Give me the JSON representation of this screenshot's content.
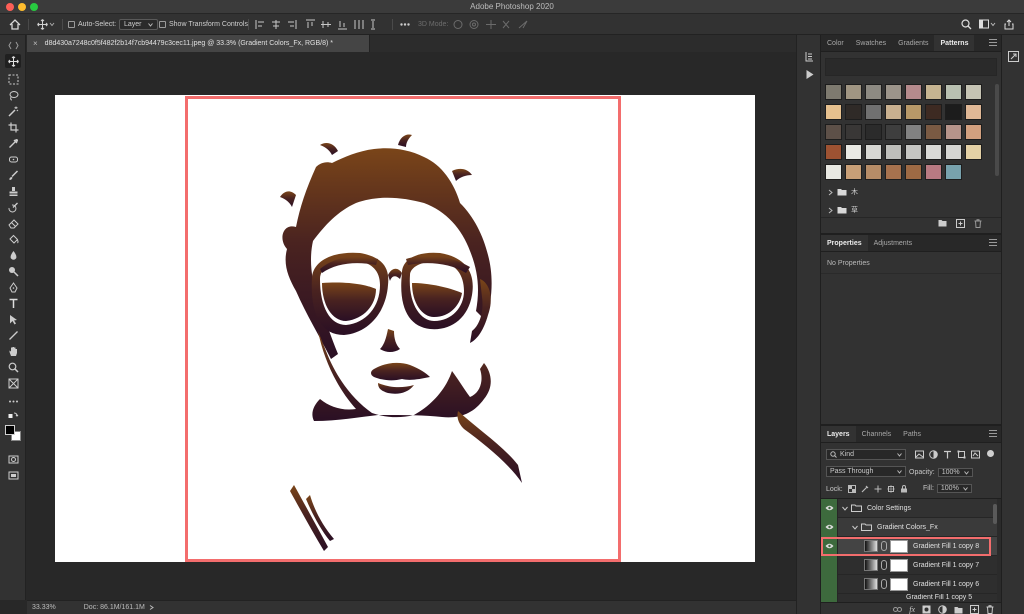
{
  "app": {
    "window_title": "Adobe Photoshop 2020"
  },
  "options_bar": {
    "auto_select_label": "Auto-Select:",
    "auto_select_value": "Layer",
    "transform_controls_label": "Show Transform Controls",
    "three_d_mode_label": "3D Mode:"
  },
  "document": {
    "tab_title": "d8d430a7248c0f5f482f2b14f7cb94479c3cec11.jpeg @ 33.3% (Gradient Colors_Fx, RGB/8) *",
    "close_glyph": "×"
  },
  "status_bar": {
    "zoom": "33.33%",
    "doc_info": "Doc: 86.1M/161.1M"
  },
  "patterns_panel": {
    "tabs": [
      "Color",
      "Swatches",
      "Gradients",
      "Patterns"
    ],
    "active_tab": "Patterns",
    "folders": [
      {
        "label": "木"
      },
      {
        "label": "草"
      }
    ],
    "swatch_colors": [
      [
        "#7e7a6f",
        "#a09582",
        "#8d8a82",
        "#9c948a",
        "#b58a8c",
        "#c6b491",
        "#b9c0b1",
        "#c5c3b3"
      ],
      [
        "#e6c08e",
        "#2f2a27",
        "#707070",
        "#c9b08f",
        "#b79868",
        "#3d2a22",
        "#1c1c1c",
        "#e0b896"
      ],
      [
        "#5d5048",
        "#393736",
        "#2b2b2b",
        "#3e3e3e",
        "#818181",
        "#7a5a43",
        "#b6948a",
        "#d2a07f"
      ],
      [
        "#9d5232",
        "#e9e9e4",
        "#d7d7d3",
        "#bfbfbb",
        "#c5c5c2",
        "#d9d9d6",
        "#d5d5d2",
        "#e3d0a5"
      ],
      [
        "#e8e8e2",
        "#c89f77",
        "#b68c67",
        "#a7724e",
        "#9e6a44",
        "#b87a82",
        "#78a2ad"
      ]
    ]
  },
  "properties_panel": {
    "tabs": [
      "Properties",
      "Adjustments"
    ],
    "active_tab": "Properties",
    "empty_text": "No Properties"
  },
  "layers_panel": {
    "tabs": [
      "Layers",
      "Channels",
      "Paths"
    ],
    "active_tab": "Layers",
    "filter_kind": "Kind",
    "blend_mode": "Pass Through",
    "opacity_label": "Opacity:",
    "opacity_value": "100%",
    "lock_label": "Lock:",
    "fill_label": "Fill:",
    "fill_value": "100%",
    "groups": [
      {
        "name": "Color Settings"
      },
      {
        "name": "Gradient Colors_Fx"
      }
    ],
    "layers": [
      {
        "name": "Gradient Fill 1 copy 8",
        "visible": true
      },
      {
        "name": "Gradient Fill 1 copy 7",
        "visible": false
      },
      {
        "name": "Gradient Fill 1 copy 6",
        "visible": false
      },
      {
        "name": "Gradient Fill 1 copy 5",
        "visible": false
      }
    ],
    "footer_fx": "fx"
  },
  "colors": {
    "highlight_red": "#f36d6d",
    "gradient_top": "#7a4519",
    "gradient_bottom": "#2a0f24"
  }
}
